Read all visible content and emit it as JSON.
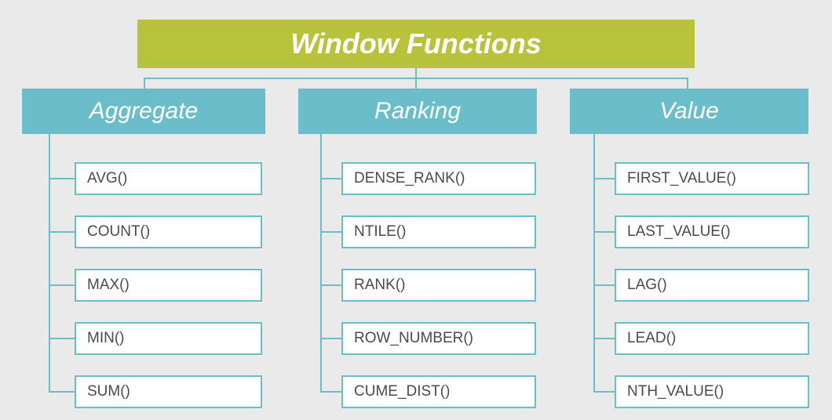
{
  "root": {
    "title": "Window Functions"
  },
  "categories": {
    "aggregate": {
      "label": "Aggregate",
      "items": [
        "AVG()",
        "COUNT()",
        "MAX()",
        "MIN()",
        "SUM()"
      ]
    },
    "ranking": {
      "label": "Ranking",
      "items": [
        "DENSE_RANK()",
        "NTILE()",
        "RANK()",
        "ROW_NUMBER()",
        "CUME_DIST()"
      ]
    },
    "value": {
      "label": "Value",
      "items": [
        "FIRST_VALUE()",
        "LAST_VALUE()",
        "LAG()",
        "LEAD()",
        "NTH_VALUE()"
      ]
    }
  },
  "colors": {
    "root_bg": "#b9c23b",
    "category_bg": "#6abec9",
    "item_border": "#6abec9",
    "item_text": "#4a4a4a",
    "page_bg": "#eaeaea"
  }
}
